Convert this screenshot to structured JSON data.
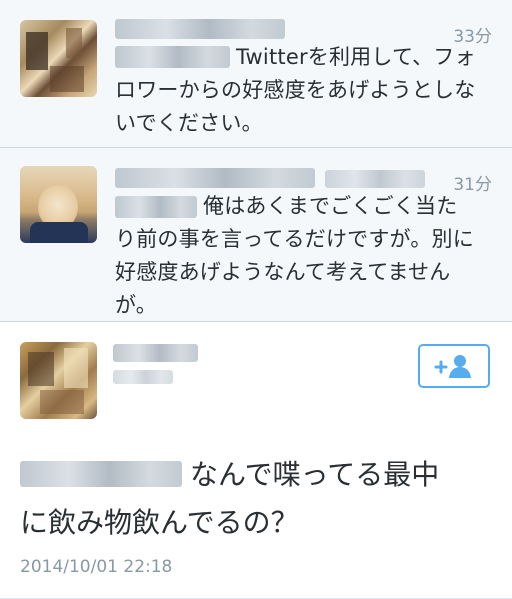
{
  "replies": [
    {
      "time": "33分",
      "text_line1": "Twitterを利用して、フォ",
      "text_line2": "ロワーからの好感度をあげようとしな",
      "text_line3": "いでください。"
    },
    {
      "time": "31分",
      "text_line1": "俺はあくまでごくごく当た",
      "text_line2": "り前の事を言ってるだけですが。別に",
      "text_line3": "好感度あげようなんて考えてません",
      "text_line4": "が。"
    }
  ],
  "main_tweet": {
    "text_line1": "なんで喋ってる最中",
    "text_line2": "に飲み物飲んでるの？",
    "date": "2014/10/01 22:18",
    "follow_icon": "add-user-icon"
  },
  "colors": {
    "accent": "#55acee",
    "muted": "#8899a6",
    "text": "#292f33"
  }
}
